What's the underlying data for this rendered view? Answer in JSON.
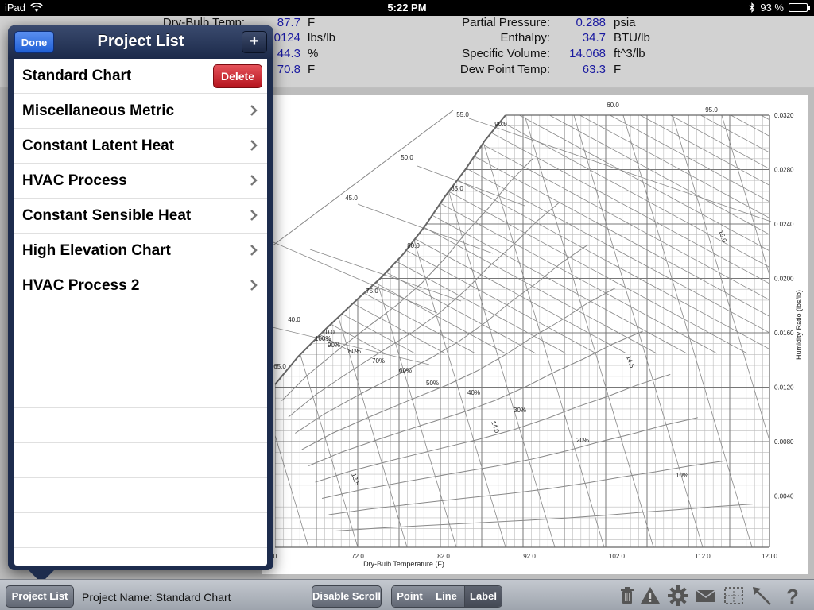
{
  "status_bar": {
    "device": "iPad",
    "time": "5:22 PM",
    "battery_pct": "93 %",
    "battery_level": 0.93
  },
  "readouts": {
    "left": [
      {
        "label": "Dry-Bulb Temp:",
        "value": "87.7",
        "unit": "F"
      },
      {
        "label": "",
        "value": "0124",
        "unit": "lbs/lb"
      },
      {
        "label": "",
        "value": "44.3",
        "unit": "%"
      },
      {
        "label": "",
        "value": "70.8",
        "unit": "F"
      }
    ],
    "right": [
      {
        "label": "Partial Pressure:",
        "value": "0.288",
        "unit": "psia"
      },
      {
        "label": "Enthalpy:",
        "value": "34.7",
        "unit": "BTU/lb"
      },
      {
        "label": "Specific Volume:",
        "value": "14.068",
        "unit": "ft^3/lb"
      },
      {
        "label": "Dew Point Temp:",
        "value": "63.3",
        "unit": "F"
      }
    ]
  },
  "popover": {
    "title": "Project List",
    "done_label": "Done",
    "add_label": "+",
    "delete_label": "Delete",
    "items": [
      {
        "name": "Standard Chart"
      },
      {
        "name": "Miscellaneous Metric"
      },
      {
        "name": "Constant Latent Heat"
      },
      {
        "name": "HVAC Process"
      },
      {
        "name": "Constant Sensible Heat"
      },
      {
        "name": "High Elevation Chart"
      },
      {
        "name": "HVAC Process 2"
      }
    ]
  },
  "chart": {
    "x_label": "Dry-Bulb Temperature (F)",
    "y_label": "Humidity Ratio (lbs/lb)",
    "x_ticks": [
      "0",
      "72.0",
      "82.0",
      "92.0",
      "102.0",
      "112.0",
      "120.0"
    ],
    "y_ticks": [
      "0.0320",
      "0.0280",
      "0.0240",
      "0.0200",
      "0.0160",
      "0.0120",
      "0.0080",
      "0.0040"
    ],
    "wetbulb_labels": [
      "40.0",
      "45.0",
      "50.0",
      "55.0",
      "65.0",
      "70.0",
      "75.0",
      "80.0",
      "85.0",
      "90.0"
    ],
    "top_labels": [
      "60.0",
      "95.0"
    ],
    "rh_labels": [
      "100%",
      "90%",
      "80%",
      "70%",
      "60%",
      "50%",
      "40%",
      "30%",
      "20%",
      "10%"
    ],
    "volume_labels": [
      "13.5",
      "14.0",
      "14.5",
      "15.0"
    ]
  },
  "toolbar": {
    "project_list_label": "Project List",
    "project_name": "Project Name: Standard Chart",
    "disable_scroll_label": "Disable Scroll",
    "modes": [
      "Point",
      "Line",
      "Label"
    ],
    "active_mode": "Label",
    "icons": [
      "trash-icon",
      "warning-icon",
      "gear-icon",
      "mail-icon",
      "selection-icon",
      "arrow-icon",
      "help-icon"
    ]
  }
}
